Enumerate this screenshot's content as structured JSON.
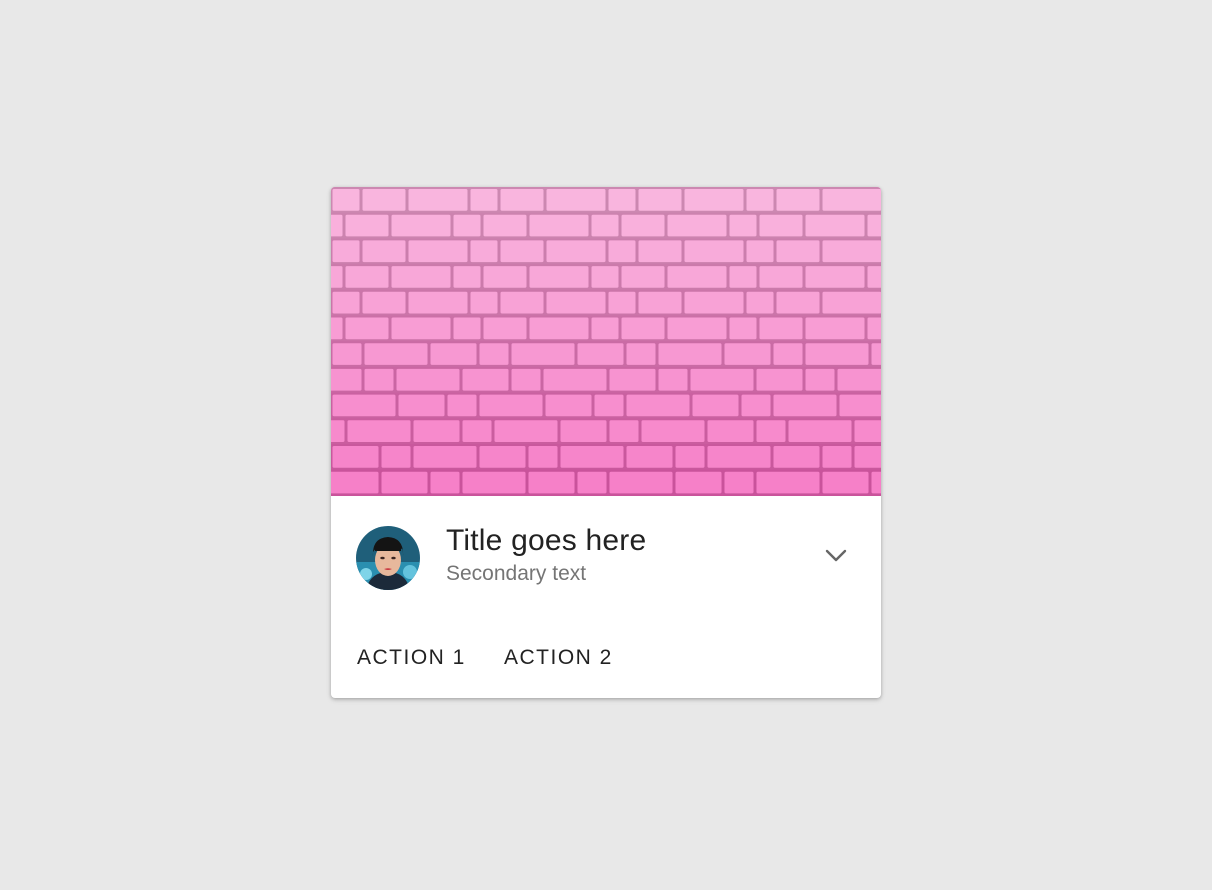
{
  "card": {
    "title": "Title goes here",
    "subtitle": "Secondary text",
    "expand_icon": "chevron-down-icon",
    "media_icon": "brick-wall-image",
    "avatar_icon": "person-avatar-image",
    "actions": [
      {
        "label": "ACTION 1"
      },
      {
        "label": "ACTION 2"
      }
    ]
  },
  "colors": {
    "background": "#e8e8e8",
    "card": "#ffffff",
    "brick": "#f78fcf",
    "mortar": "#e070b5",
    "title": "#222222",
    "subtitle": "#757575"
  }
}
